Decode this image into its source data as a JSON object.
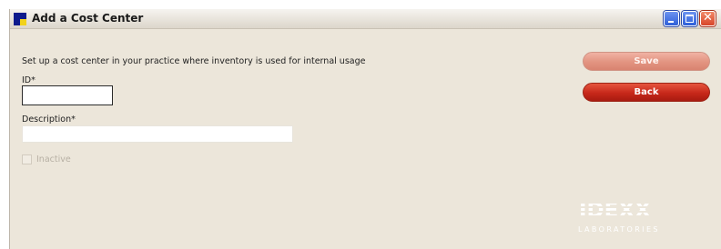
{
  "window": {
    "title": "Add a Cost Center",
    "minimize_glyph": "",
    "close_glyph": "✕"
  },
  "form": {
    "instruction": "Set up a cost center in your practice where inventory is used for internal usage",
    "id_label": "ID*",
    "id_value": "",
    "description_label": "Description*",
    "description_value": "",
    "inactive_label": "Inactive"
  },
  "buttons": {
    "save_label": "Save",
    "back_label": "Back"
  },
  "logo": {
    "brand": "IDEXX",
    "tagline": "LABORATORIES"
  },
  "colors": {
    "window_background": "#ece6da",
    "back_button": "#c7281a",
    "save_button_disabled": "#e39683"
  }
}
